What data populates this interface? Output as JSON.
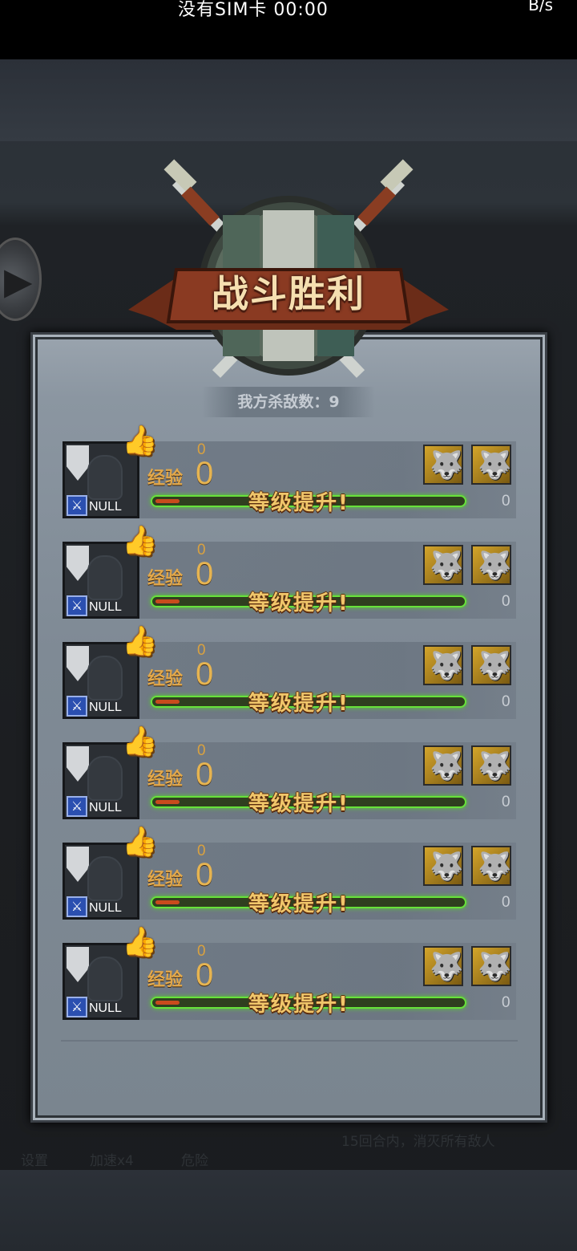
{
  "status_bar": {
    "left_text": "没有SIM卡 00:00",
    "right_text": "B/s"
  },
  "title": "战斗胜利",
  "kills": "我方杀敌数：9",
  "hud": {
    "settings": "设置",
    "speed": "加速x4",
    "danger": "危险",
    "goal": "15回合内，消灭所有敌人"
  },
  "units": [
    {
      "class_label": "NULL",
      "exp_small": "0",
      "exp_label": "经验",
      "exp_value": "0",
      "levelup": "等级提升!",
      "right_value": "0"
    },
    {
      "class_label": "NULL",
      "exp_small": "0",
      "exp_label": "经验",
      "exp_value": "0",
      "levelup": "等级提升!",
      "right_value": "0"
    },
    {
      "class_label": "NULL",
      "exp_small": "0",
      "exp_label": "经验",
      "exp_value": "0",
      "levelup": "等级提升!",
      "right_value": "0"
    },
    {
      "class_label": "NULL",
      "exp_small": "0",
      "exp_label": "经验",
      "exp_value": "0",
      "levelup": "等级提升!",
      "right_value": "0"
    },
    {
      "class_label": "NULL",
      "exp_small": "0",
      "exp_label": "经验",
      "exp_value": "0",
      "levelup": "等级提升!",
      "right_value": "0"
    },
    {
      "class_label": "NULL",
      "exp_small": "0",
      "exp_label": "经验",
      "exp_value": "0",
      "levelup": "等级提升!",
      "right_value": "0"
    }
  ],
  "colors": {
    "exp_gold": "#e6b451",
    "bar_green": "#67e23a",
    "banner_red": "#8a3a22"
  }
}
